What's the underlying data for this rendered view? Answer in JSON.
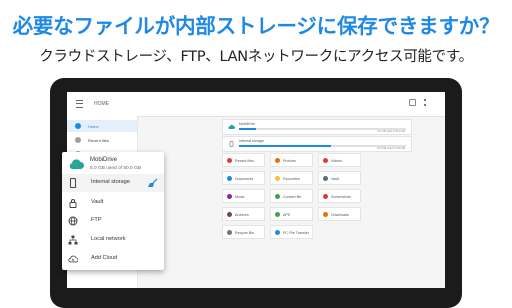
{
  "headline": "必要なファイルが内部ストレージに保存できますか？",
  "subline": "クラウドストレージ、FTP、LANネットワークにアクセス可能です。",
  "colors": {
    "accent": "#1e88e5",
    "tablet_frame": "#1b1b1b"
  },
  "app": {
    "title": "HOME",
    "toolbar_icons": [
      "view-icon",
      "more-icon"
    ],
    "left_panel": [
      {
        "label": "Home",
        "icon": "home-icon",
        "selected": true
      },
      {
        "label": "Recent files",
        "icon": "clock-icon",
        "selected": false
      },
      {
        "label": "Recycle Bin",
        "icon": "trash-icon",
        "selected": false
      }
    ],
    "storage": [
      {
        "name": "MobiDrive",
        "icon": "cloud-icon",
        "size": "5.0 GB used of 50.0 GB",
        "used_fraction": 0.1
      },
      {
        "name": "Internal storage",
        "icon": "phone-icon",
        "size": "70.5 GB used of 128 GB",
        "used_fraction": 0.55
      }
    ],
    "categories": [
      {
        "label": "Recent files",
        "color": "#e53935"
      },
      {
        "label": "Pictures",
        "color": "#ef6c00"
      },
      {
        "label": "Videos",
        "color": "#e53935"
      },
      {
        "label": "Documents",
        "color": "#1e88e5"
      },
      {
        "label": "Favourites",
        "color": "#fbc02d"
      },
      {
        "label": "Vault",
        "color": "#546e7a"
      },
      {
        "label": "Music",
        "color": "#8e24aa"
      },
      {
        "label": "Convert file",
        "color": "#43a047"
      },
      {
        "label": "Screenshots",
        "color": "#e53935"
      },
      {
        "label": "Archives",
        "color": "#6d4c41"
      },
      {
        "label": "APK",
        "color": "#43a047"
      },
      {
        "label": "Downloads",
        "color": "#ef6c00"
      },
      {
        "label": "Recycle Bin",
        "color": "#757575"
      },
      {
        "label": "PC File Transfer",
        "color": "#1e88e5"
      }
    ]
  },
  "drawer": {
    "account": {
      "name": "MobiDrive",
      "usage": "5.0 GB used of 50.0 GB",
      "icon": "cloud-icon"
    },
    "items": [
      {
        "label": "Internal storage",
        "icon": "phone-icon",
        "selected": true
      },
      {
        "label": "Vault",
        "icon": "lock-icon",
        "selected": false
      },
      {
        "label": "FTP",
        "icon": "globe-icon",
        "selected": false
      },
      {
        "label": "Local network",
        "icon": "network-icon",
        "selected": false
      },
      {
        "label": "Add Cloud",
        "icon": "add-cloud-icon",
        "selected": false
      }
    ]
  }
}
